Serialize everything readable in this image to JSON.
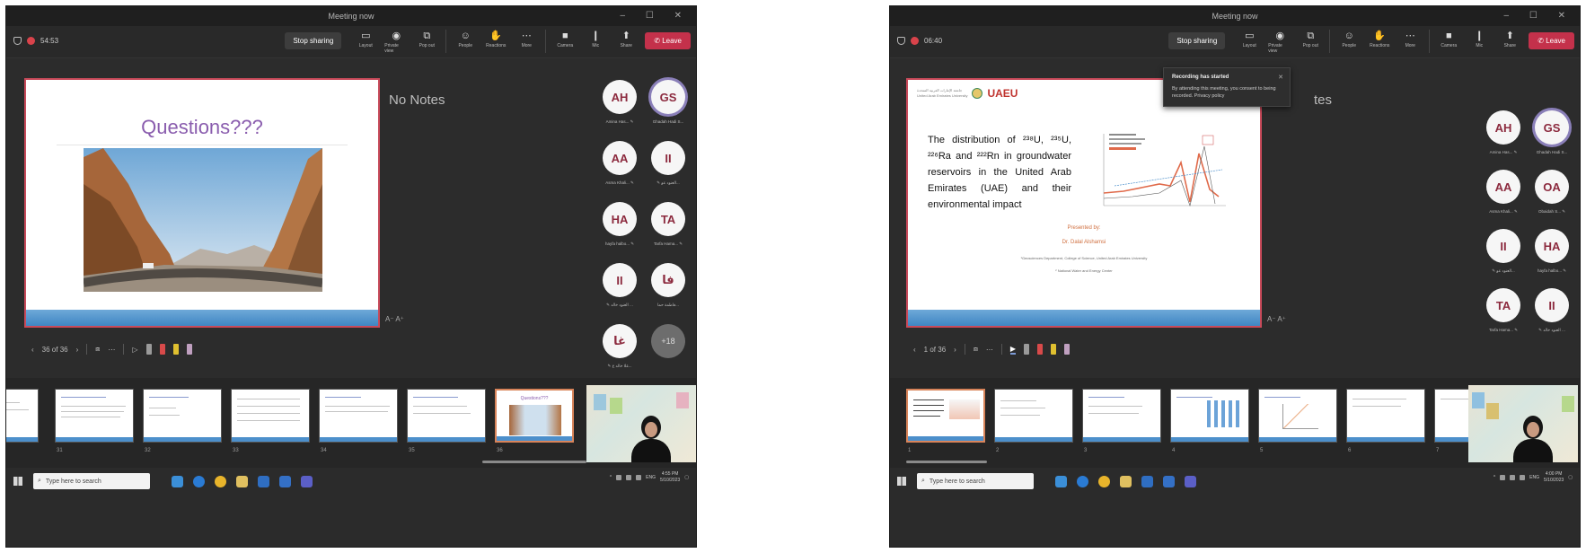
{
  "window": {
    "title": "Meeting now",
    "controls": "– ☐ ✕"
  },
  "toolbar": {
    "stop_sharing": "Stop sharing",
    "layout": "Layout",
    "presenter_view": "Private view",
    "popout": "Pop out",
    "people": "People",
    "reactions": "Reactions",
    "more": "More",
    "camera": "Camera",
    "mic": "Mic",
    "share": "Share",
    "leave": "Leave"
  },
  "left": {
    "timer": "54:53",
    "slide_title": "Questions???",
    "notes": "No Notes",
    "font_controls": "A⁻ A⁺",
    "slide_counter": "36 of 36",
    "participants": [
      {
        "initials": "AH",
        "name": "Amina Has... ✎"
      },
      {
        "initials": "GS",
        "name": "Ghadah Hadi S..."
      },
      {
        "initials": "AA",
        "name": "Asma Khali... ✎"
      },
      {
        "initials": "II",
        "name": "✎ العنود عو..."
      },
      {
        "initials": "HA",
        "name": "hayfa halbo... ✎"
      },
      {
        "initials": "TA",
        "name": "Tarfa Hama... ✎"
      },
      {
        "initials": "II",
        "name": "✎ العنود خالد ..."
      },
      {
        "initials": "فا",
        "name": "فاطمة حما..."
      },
      {
        "initials": "غا",
        "name": "✎ غلا خالد ع..."
      },
      {
        "initials": "+18",
        "name": ""
      }
    ],
    "thumb_numbers": [
      "",
      "31",
      "32",
      "33",
      "34",
      "35",
      "36"
    ]
  },
  "right": {
    "timer": "06:40",
    "notes": "tes",
    "font_controls": "A⁻ A⁺",
    "slide_counter": "1 of 36",
    "university_logo": "UAEU",
    "university_arabic": "جامعة الإمارات العربية المتحدة",
    "university_english": "United Arab Emirates University",
    "slide_heading": "The distribution of ²³⁸U, ²³⁵U, ²²⁶Ra and ²²²Rn in groundwater reservoirs in the United Arab Emirates (UAE) and their environmental impact",
    "presented_by": "Presented by:",
    "presenter": "Dr. Dalal Alshamsi",
    "affiliation_1": "¹Geosciences Department, College of Science, United Arab Emirates University",
    "affiliation_2": "² National Water and Energy Center",
    "toast_title": "Recording has started",
    "toast_body": "By attending this meeting, you consent to being recorded. Privacy policy",
    "participants": [
      {
        "initials": "AH",
        "name": "Amina Has... ✎"
      },
      {
        "initials": "GS",
        "name": "Ghadah Hadi S..."
      },
      {
        "initials": "AA",
        "name": "Asma Khali... ✎"
      },
      {
        "initials": "OA",
        "name": "Obaidah S... ✎"
      },
      {
        "initials": "II",
        "name": "✎ العنود عو..."
      },
      {
        "initials": "HA",
        "name": "hayfa halbo... ✎"
      },
      {
        "initials": "TA",
        "name": "Tarfa Hama... ✎"
      },
      {
        "initials": "II",
        "name": "✎ العنود خالد ..."
      }
    ],
    "thumb_numbers": [
      "1",
      "2",
      "3",
      "4",
      "5",
      "6",
      "7"
    ]
  },
  "taskbar": {
    "search_placeholder": "Type here to search",
    "lang": "ENG",
    "left_time": "4:55 PM",
    "left_date": "5/10/2023",
    "right_time": "4:00 PM",
    "right_date": "5/10/2023"
  },
  "colors": {
    "accent": "#c84a5a",
    "leave": "#c4314b",
    "avatar_text": "#8c2a3e",
    "slide_bar": "#3f86c3"
  }
}
